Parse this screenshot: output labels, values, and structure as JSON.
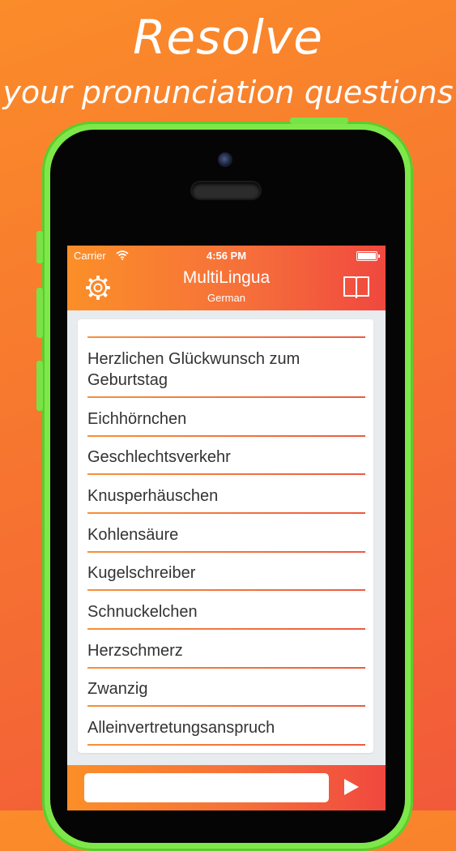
{
  "headline": {
    "line1": "Resolve",
    "line2": "your pronunciation questions"
  },
  "status": {
    "carrier": "Carrier",
    "time": "4:56 PM"
  },
  "navbar": {
    "title": "MultiLingua",
    "subtitle": "German"
  },
  "phrases": [
    "Herzlichen Glückwunsch zum",
    "Geburtstag",
    "Eichhörnchen",
    "Geschlechtsverkehr",
    "Knusperhäuschen",
    "Kohlensäure",
    "Kugelschreiber",
    "Schnuckelchen",
    "Herzschmerz",
    "Zwanzig",
    "Alleinvertretungsanspruch"
  ],
  "input": {
    "value": "",
    "placeholder": ""
  },
  "icons": {
    "settings": "gear-icon",
    "dictionary": "book-icon",
    "play": "play-icon",
    "wifi": "wifi-icon",
    "battery": "battery-icon"
  },
  "colors": {
    "accent_start": "#fb8f28",
    "accent_end": "#f0483f",
    "phone_body": "#7ee84a"
  }
}
